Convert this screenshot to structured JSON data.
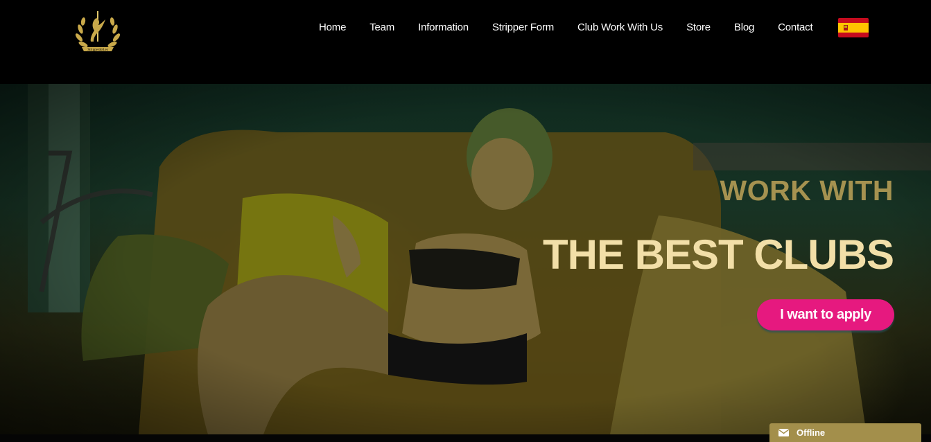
{
  "header": {
    "logo_text": "Stripperdoll.es",
    "nav": [
      {
        "label": "Home"
      },
      {
        "label": "Team"
      },
      {
        "label": "Information"
      },
      {
        "label": "Stripper Form"
      },
      {
        "label": "Club Work With Us"
      },
      {
        "label": "Store"
      },
      {
        "label": "Blog"
      },
      {
        "label": "Contact"
      }
    ],
    "language_flag_icon": "spain-flag-icon"
  },
  "hero": {
    "headline_small": "WORK WITH",
    "headline_big": "THE BEST CLUBS",
    "cta_label": "I want to apply",
    "colors": {
      "headline_small": "#a59250",
      "headline_big": "#f2dfa8",
      "cta_background": "#e6197f"
    }
  },
  "chat_widget": {
    "status": "Offline",
    "icon": "envelope-icon",
    "color": "#a38f4b"
  }
}
